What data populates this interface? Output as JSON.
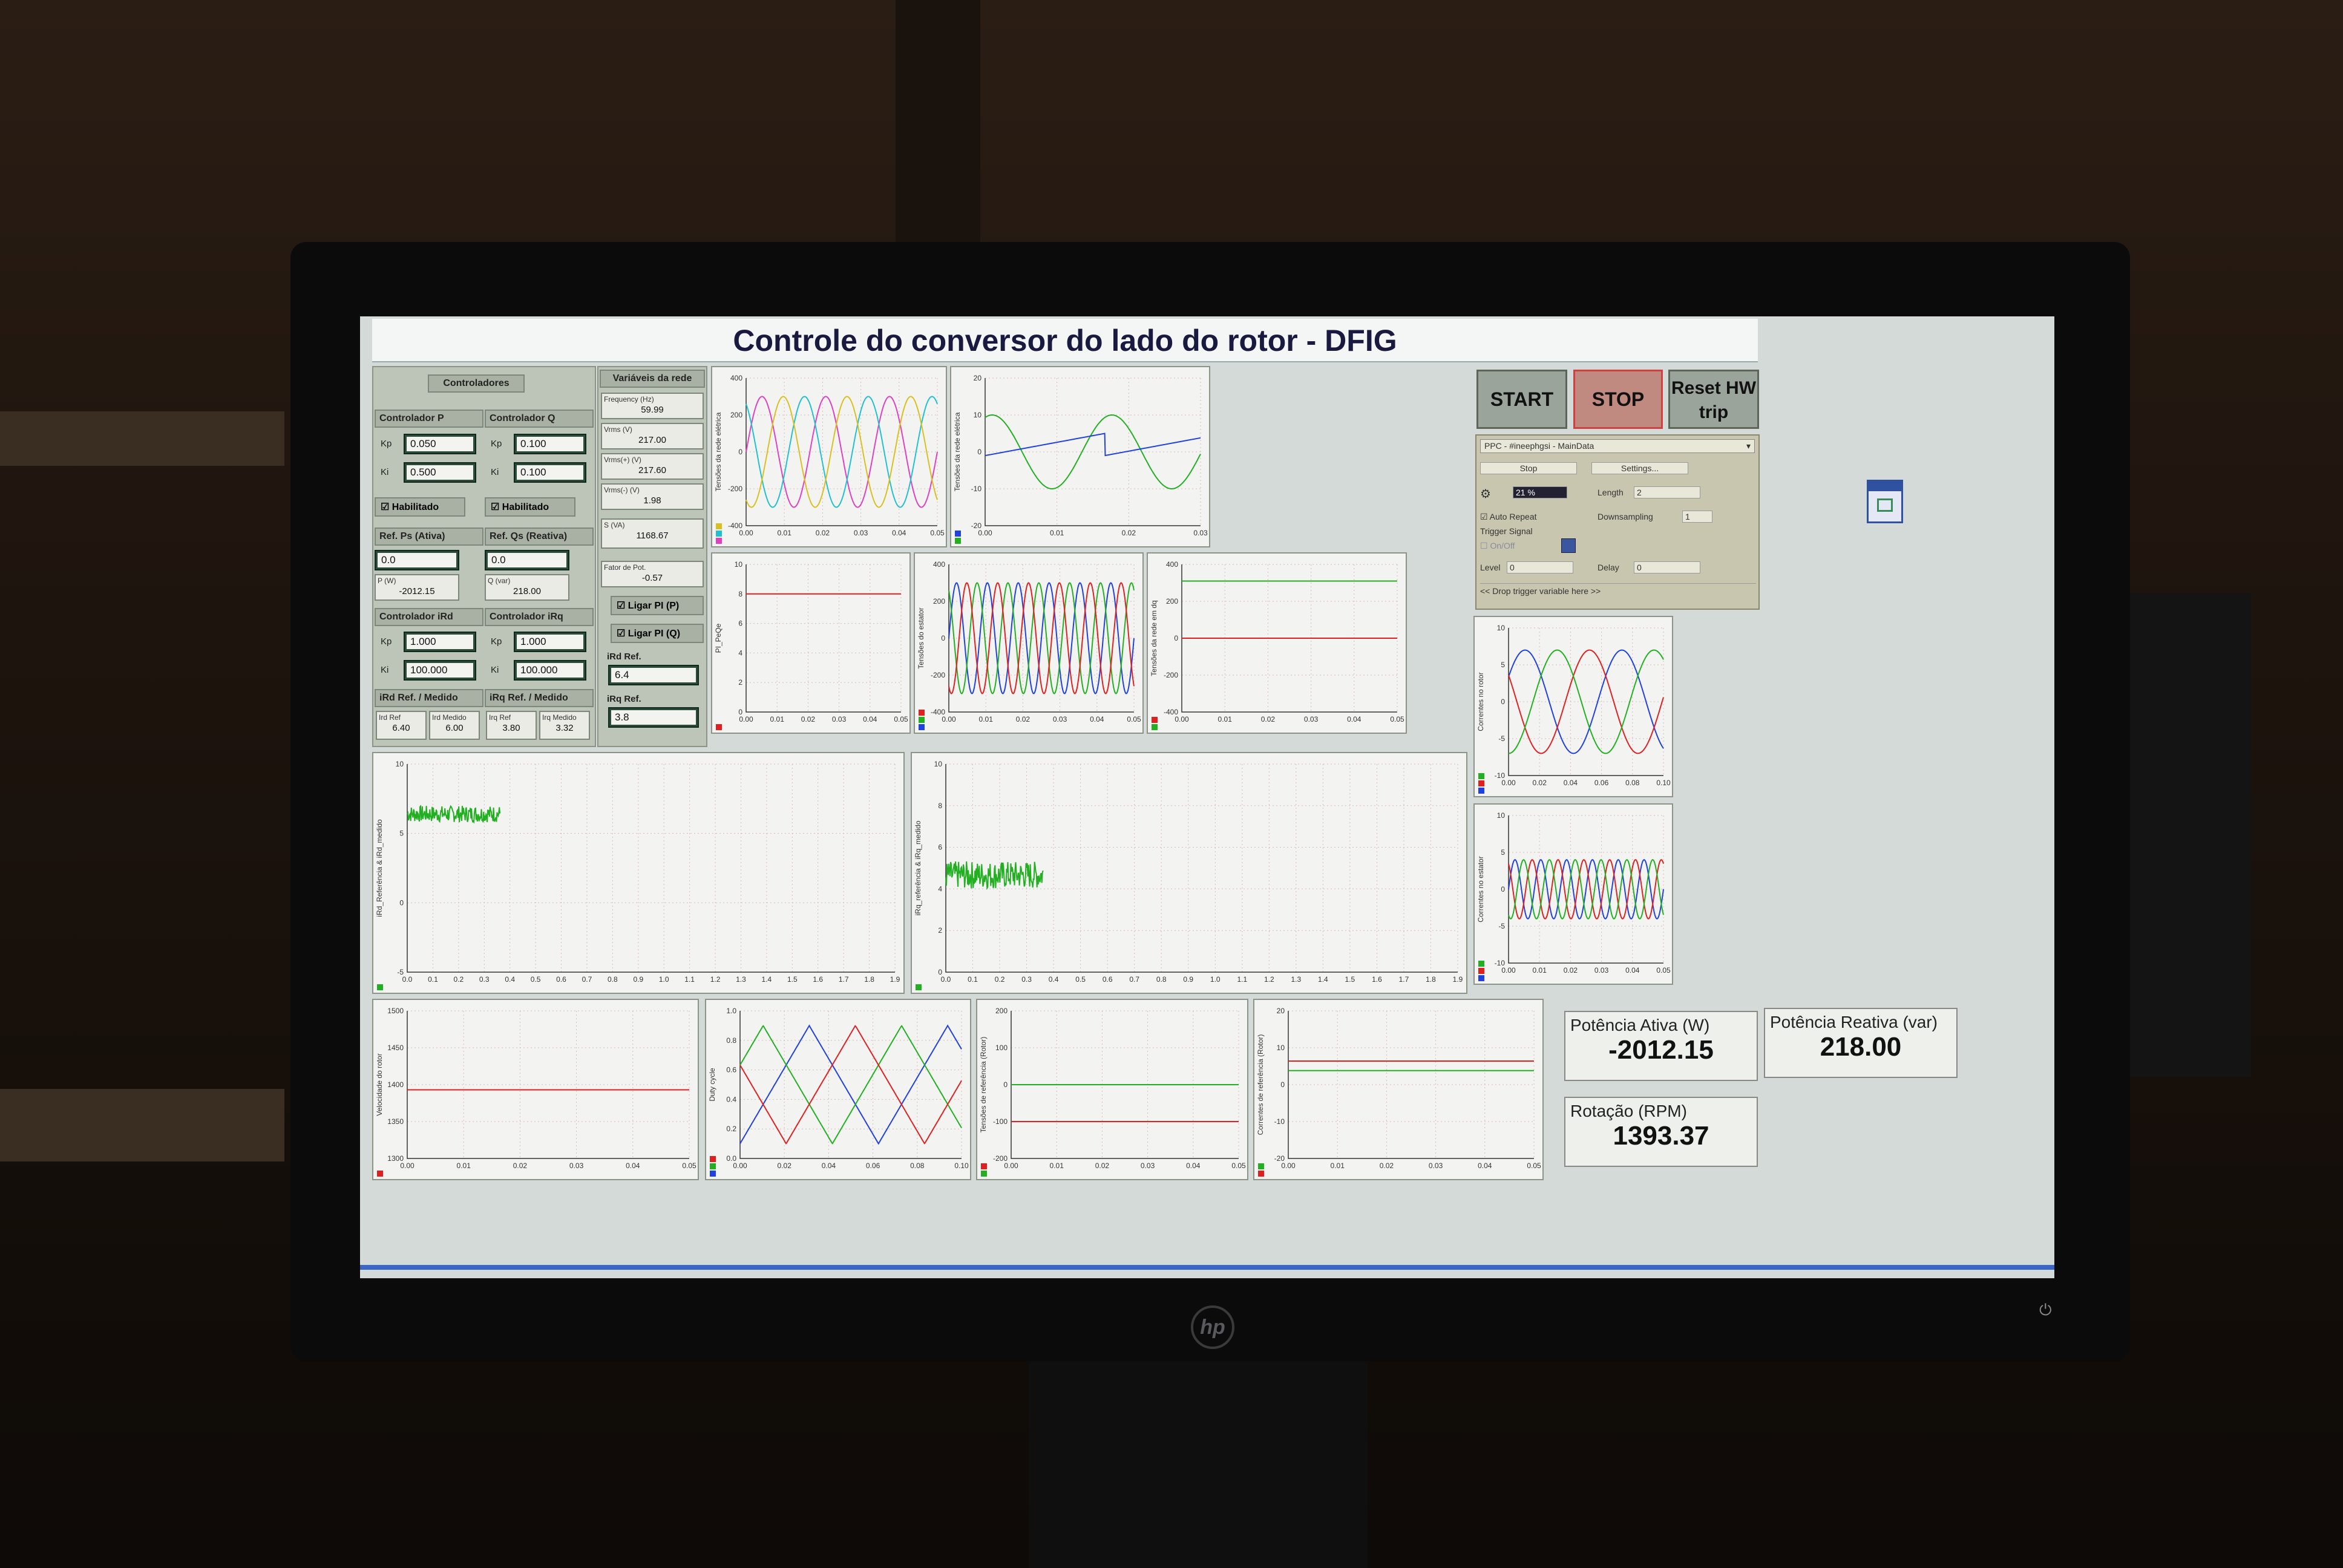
{
  "title": "Controle do conversor do lado do rotor - DFIG",
  "controladores": {
    "header": "Controladores",
    "p": {
      "title": "Controlador P",
      "kp": "0.050",
      "ki": "0.500"
    },
    "q": {
      "title": "Controlador Q",
      "kp": "0.100",
      "ki": "0.100"
    },
    "habilitado": "Habilitado",
    "ref_ps": {
      "title": "Ref. Ps (Ativa)",
      "value": "0.0",
      "p_label": "P (W)",
      "p_value": "-2012.15"
    },
    "ref_qs": {
      "title": "Ref. Qs (Reativa)",
      "value": "0.0",
      "q_label": "Q (var)",
      "q_value": "218.00"
    },
    "ird": {
      "title": "Controlador iRd",
      "kp": "1.000",
      "ki": "100.000"
    },
    "irq": {
      "title": "Controlador iRq",
      "kp": "1.000",
      "ki": "100.000"
    },
    "kp_label": "Kp",
    "ki_label": "Ki",
    "ird_ref_medido": {
      "title": "iRd Ref. / Medido",
      "ref_label": "Ird Ref",
      "ref": "6.40",
      "med_label": "Ird Medido",
      "med": "6.00"
    },
    "irq_ref_medido": {
      "title": "iRq Ref. / Medido",
      "ref_label": "Irq Ref",
      "ref": "3.80",
      "med_label": "Irq Medido",
      "med": "3.32"
    }
  },
  "variaveis": {
    "header": "Variáveis da rede",
    "frequency": {
      "label": "Frequency (Hz)",
      "value": "59.99"
    },
    "vrms": {
      "label": "Vrms (V)",
      "value": "217.00"
    },
    "vrms_pos": {
      "label": "Vrms(+) (V)",
      "value": "217.60"
    },
    "vrms_neg": {
      "label": "Vrms(-) (V)",
      "value": "1.98"
    },
    "s": {
      "label": "S (VA)",
      "value": "1168.67"
    },
    "fp": {
      "label": "Fator de Pot.",
      "value": "-0.57"
    },
    "ligar_pi_p": "Ligar PI (P)",
    "ligar_pi_q": "Ligar PI (Q)",
    "ird_ref": {
      "label": "iRd Ref.",
      "value": "6.4"
    },
    "irq_ref": {
      "label": "iRq Ref.",
      "value": "3.8"
    }
  },
  "buttons": {
    "start": "START",
    "stop": "STOP",
    "reset": "Reset HW trip"
  },
  "ppc": {
    "select": "PPC - #ineephgsi - MainData",
    "stop": "Stop",
    "settings": "Settings...",
    "progress": "21 %",
    "length_label": "Length",
    "length": "2",
    "auto_repeat": "Auto Repeat",
    "downsampling_label": "Downsampling",
    "downsampling": "1",
    "trigger_signal": "Trigger Signal",
    "on_off": "On/Off",
    "level_label": "Level",
    "level": "0",
    "delay_label": "Delay",
    "delay": "0",
    "drop": "<< Drop trigger variable here >>"
  },
  "displays": {
    "potencia_ativa": {
      "label": "Potência Ativa (W)",
      "value": "-2012.15"
    },
    "potencia_reativa": {
      "label": "Potência Reativa (var)",
      "value": "218.00"
    },
    "rotacao": {
      "label": "Rotação (RPM)",
      "value": "1393.37"
    }
  },
  "colors": {
    "red": "#e02020",
    "green": "#22b022",
    "blue": "#2040e0",
    "magenta": "#e040c0",
    "cyan": "#20c0d0",
    "yellow": "#d8c020"
  },
  "chart_data": [
    {
      "id": "c1",
      "type": "line",
      "ylabel": "Tensões da rede elétrica",
      "ylim": [
        -400,
        400
      ],
      "yticks": [
        "400",
        "200",
        "0",
        "-200",
        "-400"
      ],
      "xticks": [
        "0.00",
        "0.01",
        "0.02",
        "0.03",
        "0.04",
        "0.05"
      ],
      "xlim": [
        0,
        0.05
      ],
      "series": [
        {
          "kind": "sin",
          "amp": 300,
          "freq": 60,
          "phase": 0,
          "color": "#e040c0"
        },
        {
          "kind": "sin",
          "amp": 300,
          "freq": 60,
          "phase": 2.094,
          "color": "#20c0d0"
        },
        {
          "kind": "sin",
          "amp": 300,
          "freq": 60,
          "phase": 4.189,
          "color": "#d8c020"
        }
      ]
    },
    {
      "id": "c2",
      "type": "line",
      "ylabel": "Tensões da rede elétrica",
      "ylim": [
        -20,
        20
      ],
      "yticks": [
        "20",
        "10",
        "0",
        "-10",
        "-20"
      ],
      "xticks": [
        "0.00",
        "0.01",
        "0.02",
        "0.03"
      ],
      "xlim": [
        0,
        0.03
      ],
      "series": [
        {
          "kind": "sin",
          "amp": 10,
          "freq": 60,
          "phase": 1.2,
          "color": "#22b022"
        },
        {
          "kind": "saw",
          "amp": 6,
          "freq": 60,
          "phase": 0,
          "color": "#2040e0"
        }
      ]
    },
    {
      "id": "c3",
      "type": "line",
      "ylabel": "PI_PeQe",
      "ylim": [
        0,
        10
      ],
      "yticks": [
        "10",
        "8",
        "6",
        "4",
        "2",
        "0"
      ],
      "xticks": [
        "0.00",
        "0.01",
        "0.02",
        "0.03",
        "0.04",
        "0.05"
      ],
      "xlim": [
        0,
        0.05
      ],
      "series": [
        {
          "kind": "const",
          "value": 8,
          "color": "#e02020"
        }
      ]
    },
    {
      "id": "c4",
      "type": "line",
      "ylabel": "Tensões do estator",
      "ylim": [
        -400,
        400
      ],
      "yticks": [
        "400",
        "200",
        "0",
        "-200",
        "-400"
      ],
      "xticks": [
        "0.00",
        "0.01",
        "0.02",
        "0.03",
        "0.04",
        "0.05"
      ],
      "xlim": [
        0,
        0.05
      ],
      "series": [
        {
          "kind": "sin",
          "amp": 300,
          "freq": 120,
          "phase": 0,
          "color": "#2040e0"
        },
        {
          "kind": "sin",
          "amp": 300,
          "freq": 120,
          "phase": 2.094,
          "color": "#22b022"
        },
        {
          "kind": "sin",
          "amp": 300,
          "freq": 120,
          "phase": 4.189,
          "color": "#e02020"
        }
      ]
    },
    {
      "id": "c5",
      "type": "line",
      "ylabel": "Tensões da rede em dq",
      "ylim": [
        -400,
        400
      ],
      "yticks": [
        "400",
        "200",
        "0",
        "-200",
        "-400"
      ],
      "xticks": [
        "0.00",
        "0.01",
        "0.02",
        "0.03",
        "0.04",
        "0.05"
      ],
      "xlim": [
        0,
        0.05
      ],
      "series": [
        {
          "kind": "const",
          "value": 310,
          "color": "#22b022"
        },
        {
          "kind": "const",
          "value": 0,
          "color": "#e02020"
        }
      ]
    },
    {
      "id": "c6",
      "type": "line",
      "ylabel": "Correntes no rotor",
      "ylim": [
        -10,
        10
      ],
      "yticks": [
        "10",
        "5",
        "0",
        "-5",
        "-10"
      ],
      "xticks": [
        "0.00",
        "0.02",
        "0.04",
        "0.06",
        "0.08",
        "0.10"
      ],
      "xlim": [
        0,
        0.1
      ],
      "series": [
        {
          "kind": "sin",
          "amp": 7,
          "freq": 16,
          "phase": 0.5,
          "color": "#2040e0"
        },
        {
          "kind": "sin",
          "amp": 7,
          "freq": 16,
          "phase": 2.6,
          "color": "#e02020"
        },
        {
          "kind": "sin",
          "amp": 7,
          "freq": 16,
          "phase": 4.7,
          "color": "#22b022"
        }
      ]
    },
    {
      "id": "c7",
      "type": "line",
      "ylabel": "Correntes no estator",
      "ylim": [
        -10,
        10
      ],
      "yticks": [
        "10",
        "5",
        "0",
        "-5",
        "-10"
      ],
      "xticks": [
        "0.00",
        "0.01",
        "0.02",
        "0.03",
        "0.04",
        "0.05"
      ],
      "xlim": [
        0,
        0.05
      ],
      "series": [
        {
          "kind": "sin",
          "amp": 4,
          "freq": 120,
          "phase": 0,
          "color": "#2040e0"
        },
        {
          "kind": "sin",
          "amp": 4,
          "freq": 120,
          "phase": 2.094,
          "color": "#e02020"
        },
        {
          "kind": "sin",
          "amp": 4,
          "freq": 120,
          "phase": 4.189,
          "color": "#22b022"
        }
      ]
    },
    {
      "id": "c8",
      "type": "line",
      "ylabel": "iRd_Referência & iRd_medido",
      "ylim": [
        -5,
        10
      ],
      "yticks": [
        "10",
        "5",
        "0",
        "-5"
      ],
      "xticks": [
        "0.0",
        "0.1",
        "0.2",
        "0.3",
        "0.4",
        "0.5",
        "0.6",
        "0.7",
        "0.8",
        "0.9",
        "1.0",
        "1.1",
        "1.2",
        "1.3",
        "1.4",
        "1.5",
        "1.6",
        "1.7",
        "1.8",
        "1.9"
      ],
      "xlim": [
        0,
        2.0
      ],
      "series": [
        {
          "kind": "noise",
          "center": 6.4,
          "spread": 0.6,
          "x0": 0,
          "x1": 0.38,
          "color": "#22b022"
        }
      ]
    },
    {
      "id": "c9",
      "type": "line",
      "ylabel": "iRq_referência & iRq_medido",
      "ylim": [
        -2,
        10
      ],
      "yticks": [
        "10",
        "8",
        "6",
        "4",
        "2",
        "0"
      ],
      "xticks": [
        "0.0",
        "0.1",
        "0.2",
        "0.3",
        "0.4",
        "0.5",
        "0.6",
        "0.7",
        "0.8",
        "0.9",
        "1.0",
        "1.1",
        "1.2",
        "1.3",
        "1.4",
        "1.5",
        "1.6",
        "1.7",
        "1.8",
        "1.9"
      ],
      "xlim": [
        0,
        2.0
      ],
      "series": [
        {
          "kind": "noise",
          "center": 3.6,
          "spread": 0.8,
          "x0": 0,
          "x1": 0.38,
          "color": "#22b022"
        }
      ]
    },
    {
      "id": "c10",
      "type": "line",
      "ylabel": "Velocidade do rotor",
      "ylim": [
        1300,
        1500
      ],
      "yticks": [
        "1500",
        "1450",
        "1400",
        "1350",
        "1300"
      ],
      "xticks": [
        "0.00",
        "0.01",
        "0.02",
        "0.03",
        "0.04",
        "0.05"
      ],
      "xlim": [
        0,
        0.05
      ],
      "series": [
        {
          "kind": "const",
          "value": 1393,
          "color": "#e02020"
        }
      ]
    },
    {
      "id": "c11",
      "type": "line",
      "ylabel": "Duty cycle",
      "ylim": [
        0,
        1
      ],
      "yticks": [
        "1.0",
        "0.8",
        "0.6",
        "0.4",
        "0.2",
        "0.0"
      ],
      "xticks": [
        "0.00",
        "0.02",
        "0.04",
        "0.06",
        "0.08",
        "0.10"
      ],
      "xlim": [
        0,
        0.1
      ],
      "series": [
        {
          "kind": "tri",
          "freq": 16,
          "phase": 0,
          "color": "#2040e0"
        },
        {
          "kind": "tri",
          "freq": 16,
          "phase": 0.333,
          "color": "#22b022"
        },
        {
          "kind": "tri",
          "freq": 16,
          "phase": 0.667,
          "color": "#e02020"
        }
      ]
    },
    {
      "id": "c12",
      "type": "line",
      "ylabel": "Tensões de referência (Rotor)",
      "ylim": [
        -200,
        200
      ],
      "yticks": [
        "200",
        "100",
        "0",
        "-100",
        "-200"
      ],
      "xticks": [
        "0.00",
        "0.01",
        "0.02",
        "0.03",
        "0.04",
        "0.05"
      ],
      "xlim": [
        0,
        0.05
      ],
      "series": [
        {
          "kind": "const",
          "value": 0,
          "color": "#22b022"
        },
        {
          "kind": "const",
          "value": -100,
          "color": "#e02020"
        }
      ]
    },
    {
      "id": "c13",
      "type": "line",
      "ylabel": "Correntes de referência (Rotor)",
      "ylim": [
        -20,
        20
      ],
      "yticks": [
        "20",
        "10",
        "0",
        "-10",
        "-20"
      ],
      "xticks": [
        "0.00",
        "0.01",
        "0.02",
        "0.03",
        "0.04",
        "0.05"
      ],
      "xlim": [
        0,
        0.05
      ],
      "series": [
        {
          "kind": "const",
          "value": 6.4,
          "color": "#e02020"
        },
        {
          "kind": "const",
          "value": 3.8,
          "color": "#22b022"
        }
      ]
    }
  ]
}
